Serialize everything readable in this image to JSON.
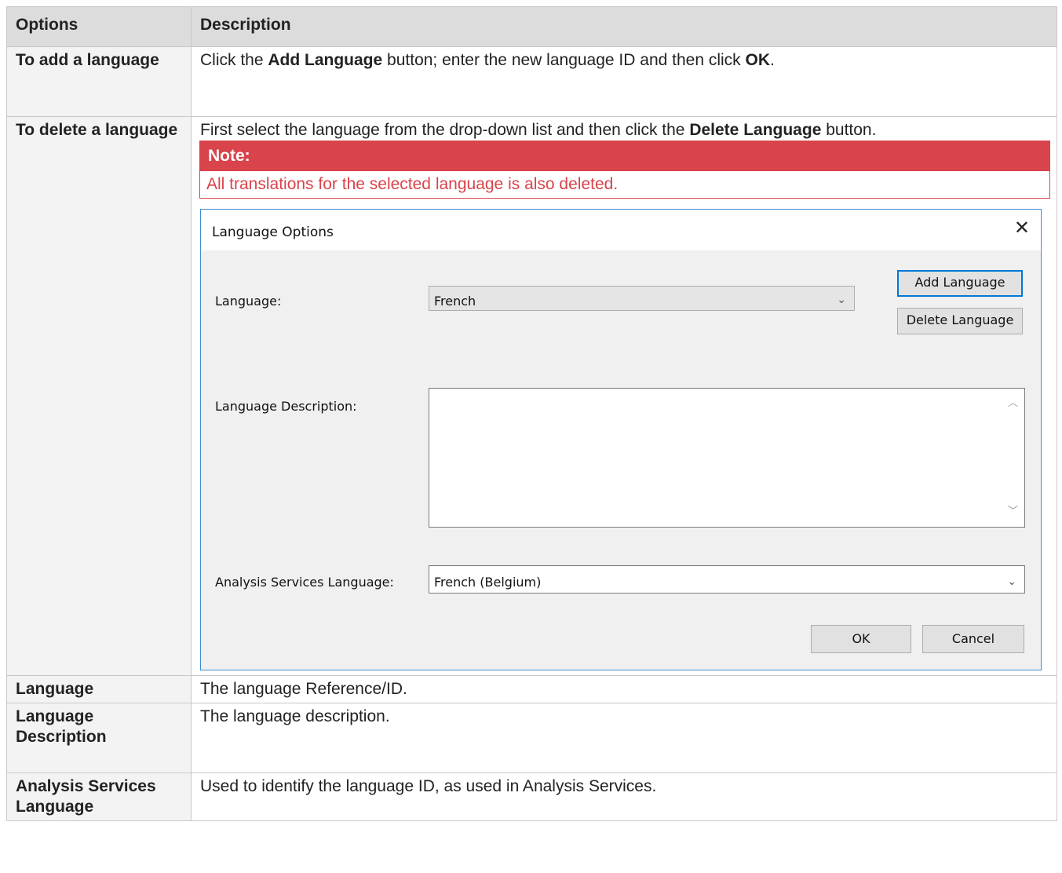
{
  "table": {
    "headers": [
      "Options",
      "Description"
    ],
    "rows": [
      {
        "option": "To add a language",
        "desc_parts": [
          "Click the ",
          "Add Language",
          " button; enter the new language ID and then click ",
          "OK",
          "."
        ]
      },
      {
        "option": "To delete a language",
        "desc_parts": [
          " First select the language from the drop-down list and then click the ",
          "Delete Language",
          " button."
        ],
        "note": {
          "title": "Note:",
          "text": "All translations for the selected language is also deleted."
        }
      },
      {
        "option": "Language",
        "desc": "The language Reference/ID."
      },
      {
        "option": " Language Description",
        "desc": "The language description."
      },
      {
        "option": "Analysis Services Language",
        "desc": "Used to identify the language ID, as used in Analysis Services."
      }
    ]
  },
  "dialog": {
    "title": "Language Options",
    "close_icon": "close-icon",
    "language_label": "Language:",
    "language_value": "French",
    "add_language": "Add Language",
    "delete_language": "Delete Language",
    "description_label": "Language Description:",
    "description_value": "",
    "as_language_label": "Analysis Services Language:",
    "as_language_value": "French (Belgium)",
    "ok": "OK",
    "cancel": "Cancel"
  },
  "colors": {
    "note_red": "#d9434b",
    "dialog_border": "#3c8fd5",
    "header_bg": "#dcdcdc",
    "option_cell_bg": "#f3f3f3"
  }
}
